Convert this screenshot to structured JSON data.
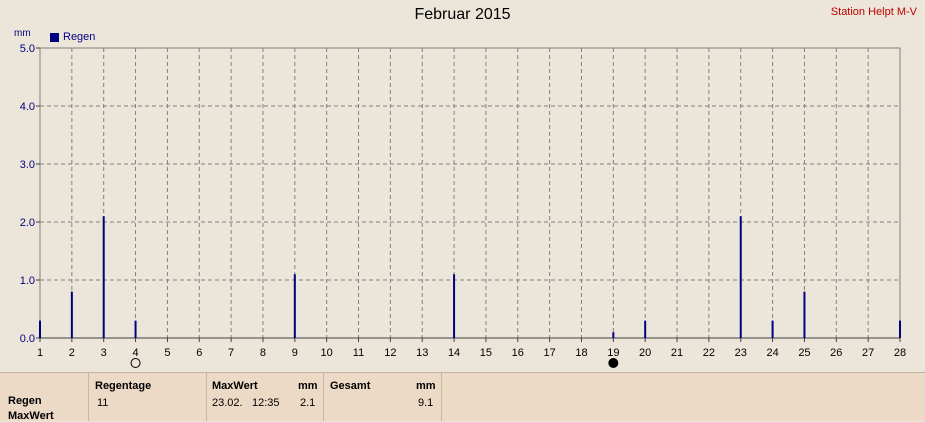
{
  "header": {
    "title": "Februar 2015",
    "station": "Station Helpt M-V"
  },
  "chart_data": {
    "type": "bar",
    "title": "Februar 2015",
    "ylabel": "mm",
    "ylim": [
      0,
      5
    ],
    "yticks": [
      "0.0",
      "1.0",
      "2.0",
      "3.0",
      "4.0",
      "5.0"
    ],
    "x": [
      1,
      2,
      3,
      4,
      5,
      6,
      7,
      8,
      9,
      10,
      11,
      12,
      13,
      14,
      15,
      16,
      17,
      18,
      19,
      20,
      21,
      22,
      23,
      24,
      25,
      26,
      27,
      28
    ],
    "series": [
      {
        "name": "Regen",
        "color": "#000080",
        "values": [
          0.3,
          0.8,
          2.1,
          0.3,
          0,
          0,
          0,
          0,
          1.1,
          0,
          0,
          0,
          0,
          1.1,
          0,
          0,
          0,
          0,
          0.1,
          0.3,
          0,
          0,
          2.1,
          0.3,
          0.8,
          0,
          0,
          0.3
        ]
      }
    ],
    "grid": true,
    "legend_position": "top-left",
    "moon_phases": [
      {
        "day": 4,
        "phase": "full-moon"
      },
      {
        "day": 19,
        "phase": "new-moon"
      }
    ]
  },
  "table": {
    "row_labels": [
      "Regen",
      "MaxWert"
    ],
    "regentage": {
      "header": "Regentage",
      "value": "11"
    },
    "maxwert": {
      "header": "MaxWert",
      "unit": "mm",
      "date": "23.02.",
      "time": "12:35",
      "value": "2.1"
    },
    "gesamt": {
      "header": "Gesamt",
      "unit": "mm",
      "value": "9.1"
    }
  }
}
